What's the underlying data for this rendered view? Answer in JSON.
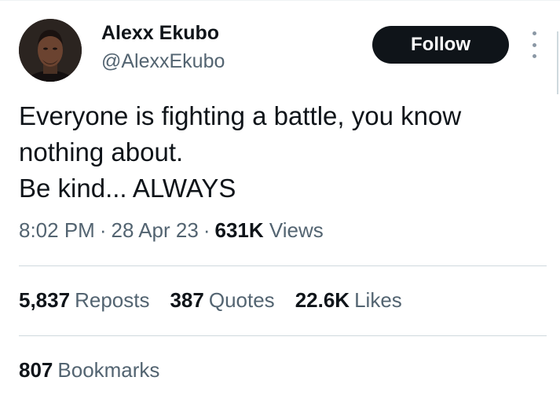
{
  "author": {
    "name": "Alexx Ekubo",
    "handle": "@AlexxEkubo",
    "avatar_icon": "profile-photo"
  },
  "follow_button": {
    "label": "Follow"
  },
  "tweet": {
    "lines": [
      "Everyone is fighting a battle, you know",
      "nothing about.",
      "Be kind...  ALWAYS"
    ]
  },
  "meta": {
    "time": "8:02 PM",
    "separator": "·",
    "date": "28 Apr 23",
    "views_count": "631K",
    "views_label": "Views"
  },
  "stats": {
    "reposts": {
      "count": "5,837",
      "label": "Reposts"
    },
    "quotes": {
      "count": "387",
      "label": "Quotes"
    },
    "likes": {
      "count": "22.6K",
      "label": "Likes"
    }
  },
  "bookmarks": {
    "count": "807",
    "label": "Bookmarks"
  },
  "colors": {
    "text_primary": "#0f1419",
    "text_secondary": "#536471",
    "divider": "#cfd9de",
    "follow_bg": "#0f1419"
  }
}
